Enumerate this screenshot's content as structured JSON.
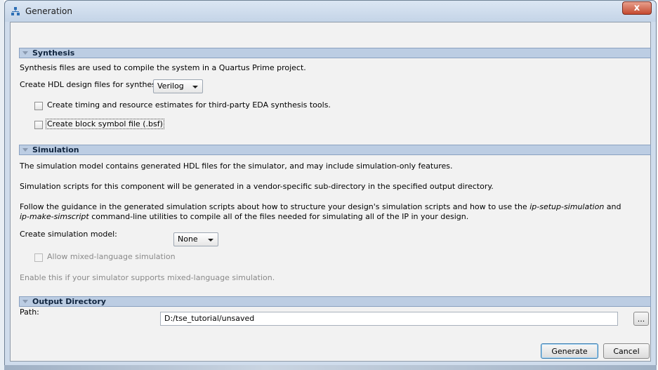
{
  "window": {
    "title": "Generation",
    "close_label": "x"
  },
  "synthesis": {
    "header": "Synthesis",
    "description": "Synthesis files are used to compile the system in a Quartus Prime project.",
    "hdl_label": "Create HDL design files for synthesis:",
    "hdl_value": "Verilog",
    "timing_checkbox_label": "Create timing and resource estimates for third-party EDA synthesis tools.",
    "timing_checked": false,
    "bsf_checkbox_label": "Create block symbol file (.bsf)",
    "bsf_checked": false
  },
  "simulation": {
    "header": "Simulation",
    "desc1": "The simulation model contains generated HDL files for the simulator, and may include simulation-only features.",
    "desc2": "Simulation scripts for this component will be generated in a vendor-specific sub-directory in the specified output directory.",
    "desc3_part1": "Follow the guidance in the generated simulation scripts about how to structure your design's simulation scripts and how to use the ",
    "desc3_em1": "ip-setup-simulation",
    "desc3_part2": " and",
    "desc3_em2": "ip-make-simscript",
    "desc3_part3": " command-line utilities to compile all of the files needed for simulating all of the IP in your design.",
    "model_label": "Create simulation model:",
    "model_value": "None",
    "mixed_checkbox_label": "Allow mixed-language simulation",
    "mixed_checked": false,
    "mixed_hint": "Enable this if your simulator supports mixed-language simulation."
  },
  "output": {
    "header": "Output Directory",
    "path_label": "Path:",
    "path_value": "D:/tse_tutorial/unsaved",
    "browse_label": "..."
  },
  "buttons": {
    "generate": "Generate",
    "cancel": "Cancel"
  }
}
